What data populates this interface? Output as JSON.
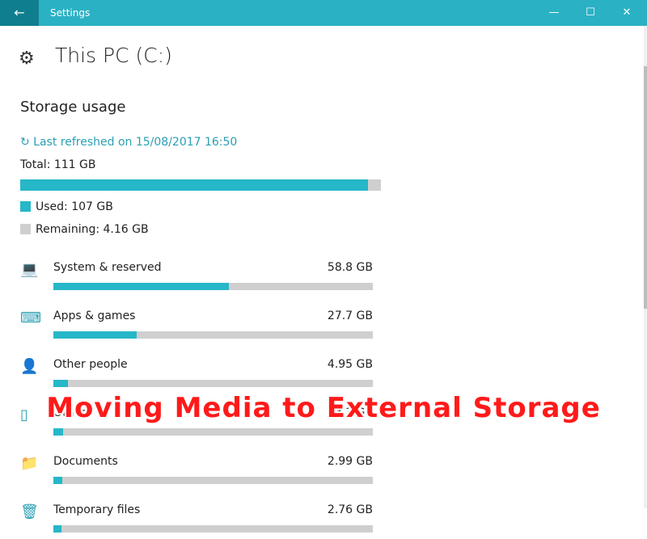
{
  "window": {
    "title": "Settings",
    "back_glyph": "←",
    "minimize_glyph": "—",
    "maximize_glyph": "☐",
    "close_glyph": "✕"
  },
  "page": {
    "title": "This PC (C:)",
    "gear_glyph": "⚙"
  },
  "storage": {
    "heading": "Storage usage",
    "refresh": "↻ Last refreshed on 15/08/2017 16:50",
    "total": "Total: 111 GB",
    "used_fraction": 0.964,
    "used": "Used: 107 GB",
    "remaining": "Remaining: 4.16 GB",
    "colors": {
      "used": "#26b7c8",
      "remaining": "#cfcfcf",
      "accent": "#2bb1c4"
    }
  },
  "categories": [
    {
      "name": "System & reserved",
      "size": "58.8 GB",
      "fraction": 0.55,
      "icon": "laptop-icon",
      "glyph": "💻"
    },
    {
      "name": "Apps & games",
      "size": "27.7 GB",
      "fraction": 0.26,
      "icon": "keyboard-icon",
      "glyph": "⌨"
    },
    {
      "name": "Other people",
      "size": "4.95 GB",
      "fraction": 0.045,
      "icon": "person-icon",
      "glyph": "👤"
    },
    {
      "name": "Other",
      "size": "3.3 GB",
      "fraction": 0.03,
      "icon": "other-icon",
      "glyph": "▯"
    },
    {
      "name": "Documents",
      "size": "2.99 GB",
      "fraction": 0.028,
      "icon": "folder-icon",
      "glyph": "📁"
    },
    {
      "name": "Temporary files",
      "size": "2.76 GB",
      "fraction": 0.026,
      "icon": "trash-icon",
      "glyph": "🗑"
    }
  ],
  "overlay_caption": "Moving Media to External Storage"
}
